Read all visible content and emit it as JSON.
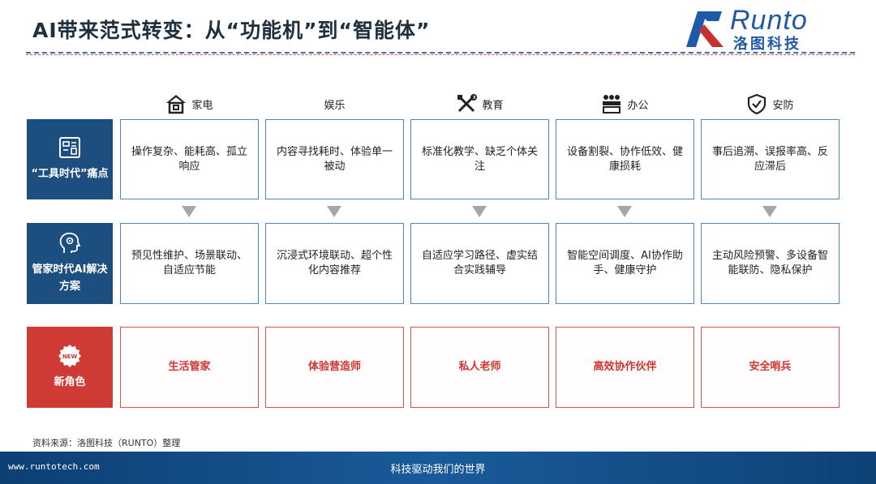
{
  "title": "AI带来范式转变：从“功能机”到“智能体”",
  "logo": {
    "text_en": "Runto",
    "text_cn": "洛图科技",
    "brand_color": "#1e5aa8",
    "accent_color": "#c8302b"
  },
  "columns": [
    {
      "label": "家电",
      "icon": "house-icon"
    },
    {
      "label": "娱乐",
      "icon": ""
    },
    {
      "label": "教育",
      "icon": "tools-icon"
    },
    {
      "label": "办公",
      "icon": "office-people-icon"
    },
    {
      "label": "安防",
      "icon": "shield-check-icon"
    }
  ],
  "rows": [
    {
      "label": "“工具时代”痛点",
      "icon": "dashboard-icon",
      "cells": [
        "操作复杂、能耗高、孤立响应",
        "内容寻找耗时、体验单一被动",
        "标准化教学、缺乏个体关注",
        "设备割裂、协作低效、健康损耗",
        "事后追溯、误报率高、反应滞后"
      ]
    },
    {
      "label": "管家时代AI解决方案",
      "icon": "ai-head-icon",
      "cells": [
        "预见性维护、场景联动、自适应节能",
        "沉浸式环境联动、超个性化内容推荐",
        "自适应学习路径、虚实结合实践辅导",
        "智能空间调度、AI协作助手、健康守护",
        "主动风险预警、多设备智能联防、隐私保护"
      ]
    },
    {
      "label": "新角色",
      "icon": "new-badge-icon",
      "badge_text": "NEW",
      "cells": [
        "生活管家",
        "体验营造师",
        "私人老师",
        "高效协作伙伴",
        "安全哨兵"
      ]
    }
  ],
  "source": "资料来源：洛图科技（RUNTO）整理",
  "footer": {
    "url": "www.runtotech.com",
    "slogan": "科技驱动我们的世界"
  },
  "colors": {
    "row_blue": "#1d4e80",
    "row_red": "#cf3a35",
    "cell_border_blue": "#4f86c0",
    "cell_border_red": "#d9534f",
    "footer": "#1a5a9a"
  }
}
